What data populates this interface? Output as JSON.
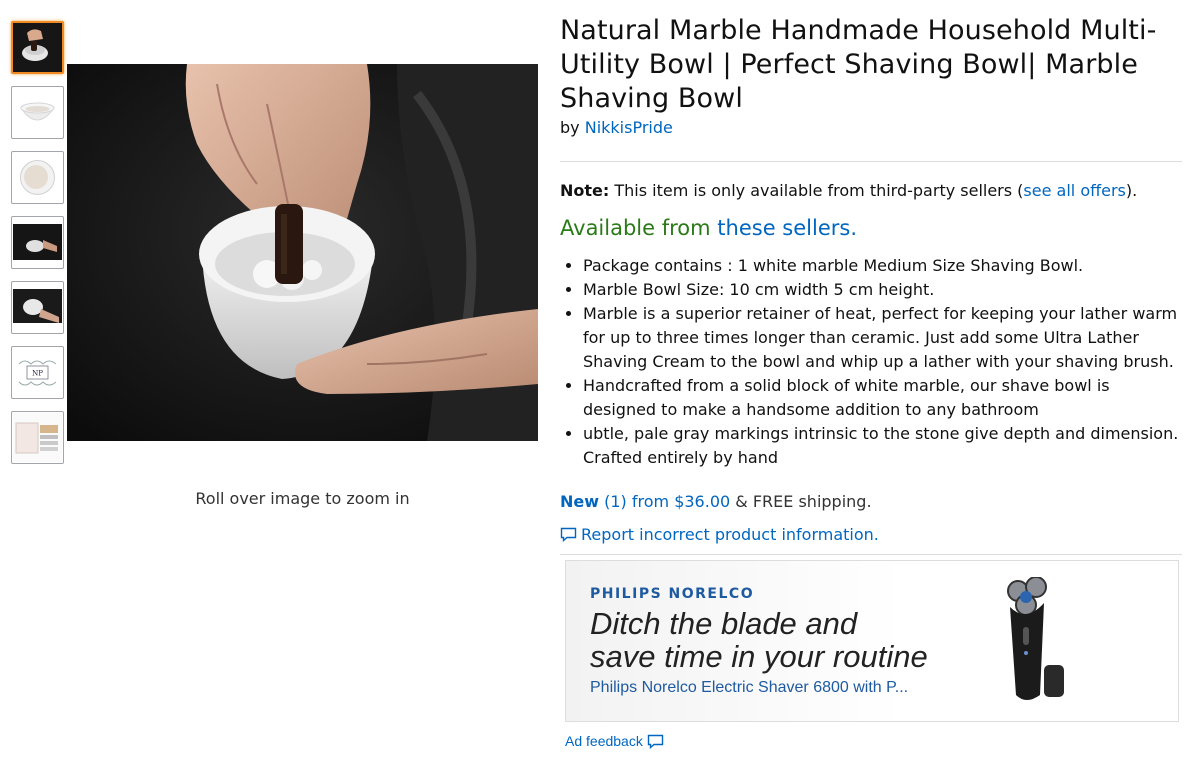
{
  "gallery": {
    "thumbnails": [
      {
        "icon": "hands-bowl-thumbnail",
        "selected": true
      },
      {
        "icon": "bowl-side-thumbnail",
        "selected": false
      },
      {
        "icon": "bowl-top-thumbnail",
        "selected": false
      },
      {
        "icon": "bowl-dark-thumbnail",
        "selected": false
      },
      {
        "icon": "bowl-hand-thumbnail",
        "selected": false
      },
      {
        "icon": "logo-thumbnail",
        "selected": false
      },
      {
        "icon": "package-thumbnail",
        "selected": false
      }
    ],
    "logo_text": "NP",
    "zoom_hint": "Roll over image to zoom in"
  },
  "product": {
    "title": "Natural Marble Handmade Household Multi- Utility Bowl | Perfect Shaving Bowl| Marble Shaving Bowl",
    "by_label": "by",
    "brand": "NikkisPride",
    "note_label": "Note:",
    "note_text": "This item is only available from third-party sellers (",
    "note_link": "see all offers",
    "note_end": ").",
    "available_prefix": "Available from",
    "available_link": "these sellers.",
    "bullets": [
      "Package contains : 1 white marble Medium Size Shaving Bowl.",
      "Marble Bowl Size: 10 cm width 5 cm height.",
      "Marble is a superior retainer of heat, perfect for keeping your lather warm for up to three times longer than ceramic. Just add some Ultra Lather Shaving Cream to the bowl and whip up a lather with your shaving brush.",
      "Handcrafted from a solid block of white marble, our shave bowl is designed to make a handsome addition to any bathroom",
      "ubtle, pale gray markings intrinsic to the stone give depth and dimension. Crafted entirely by hand"
    ],
    "offer_new": "New",
    "offer_link": "(1) from $36.00",
    "offer_shipping": "& FREE shipping.",
    "report_link": "Report incorrect product information."
  },
  "ad": {
    "brand": "PHILIPS NORELCO",
    "headline_line1": "Ditch the blade and",
    "headline_line2": "save time in your routine",
    "product": "Philips Norelco Electric Shaver 6800 with P...",
    "feedback": "Ad feedback"
  },
  "colors": {
    "link": "#0066c0",
    "available": "#2a7a18",
    "selected_thumb": "#f08a24"
  }
}
